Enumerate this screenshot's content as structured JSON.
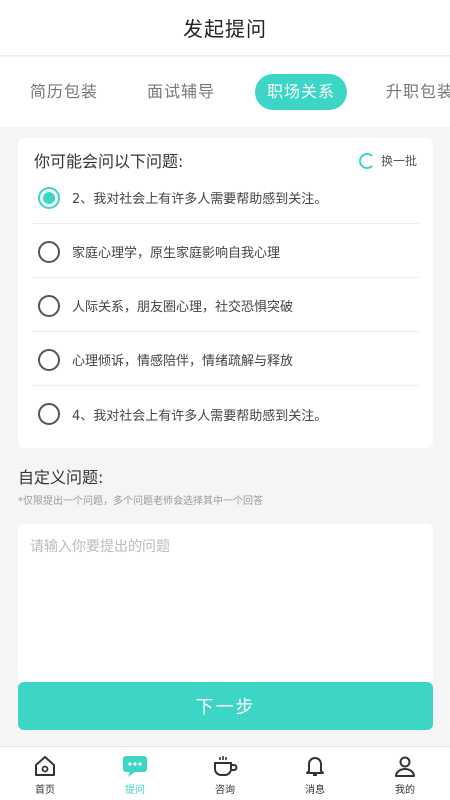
{
  "header": {
    "title": "发起提问"
  },
  "tabs": [
    {
      "label": "简历包装",
      "active": false
    },
    {
      "label": "面试辅导",
      "active": false
    },
    {
      "label": "职场关系",
      "active": true
    },
    {
      "label": "升职包装",
      "active": false
    }
  ],
  "questions": {
    "heading": "你可能会问以下问题:",
    "refresh_label": "换一批",
    "options": [
      {
        "text": "2、我对社会上有许多人需要帮助感到关注。",
        "selected": true
      },
      {
        "text": "家庭心理学，原生家庭影响自我心理",
        "selected": false
      },
      {
        "text": "人际关系，朋友圈心理，社交恐惧突破",
        "selected": false
      },
      {
        "text": "心理倾诉，情感陪伴，情绪疏解与释放",
        "selected": false
      },
      {
        "text": "4、我对社会上有许多人需要帮助感到关注。",
        "selected": false
      }
    ]
  },
  "custom": {
    "title": "自定义问题:",
    "note": "*仅限提出一个问题，多个问题老师会选择其中一个回答",
    "placeholder": "请输入你要提出的问题",
    "value": ""
  },
  "next_button": {
    "label": "下一步"
  },
  "tabbar": {
    "items": [
      {
        "label": "首页",
        "icon": "home-icon",
        "active": false
      },
      {
        "label": "提问",
        "icon": "chat-icon",
        "active": true
      },
      {
        "label": "咨询",
        "icon": "coffee-icon",
        "active": false
      },
      {
        "label": "消息",
        "icon": "bell-icon",
        "active": false
      },
      {
        "label": "我的",
        "icon": "user-icon",
        "active": false
      }
    ]
  },
  "colors": {
    "accent": "#3dd6c6",
    "background": "#f5f5f5"
  }
}
